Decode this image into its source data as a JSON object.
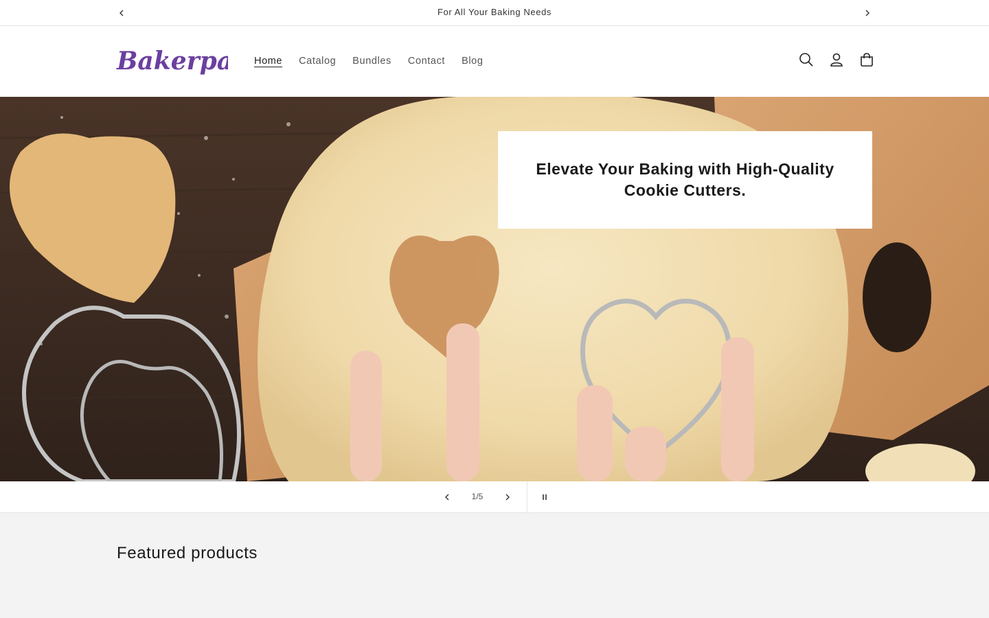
{
  "announcement": {
    "text": "For All Your Baking Needs",
    "prev_icon": "chevron-left-icon",
    "next_icon": "chevron-right-icon"
  },
  "header": {
    "logo_text": "Bakerpan",
    "brand_color": "#6b3fa0",
    "nav": [
      {
        "label": "Home",
        "active": true
      },
      {
        "label": "Catalog",
        "active": false
      },
      {
        "label": "Bundles",
        "active": false
      },
      {
        "label": "Contact",
        "active": false
      },
      {
        "label": "Blog",
        "active": false
      }
    ],
    "icons": [
      "search-icon",
      "account-icon",
      "cart-icon"
    ]
  },
  "hero": {
    "heading": "Elevate Your Baking with High-Quality Cookie Cutters."
  },
  "slider": {
    "current": "1",
    "separator": "/",
    "total": "5",
    "prev_icon": "chevron-left-icon",
    "next_icon": "chevron-right-icon",
    "pause_icon": "pause-icon"
  },
  "featured": {
    "title": "Featured products"
  }
}
